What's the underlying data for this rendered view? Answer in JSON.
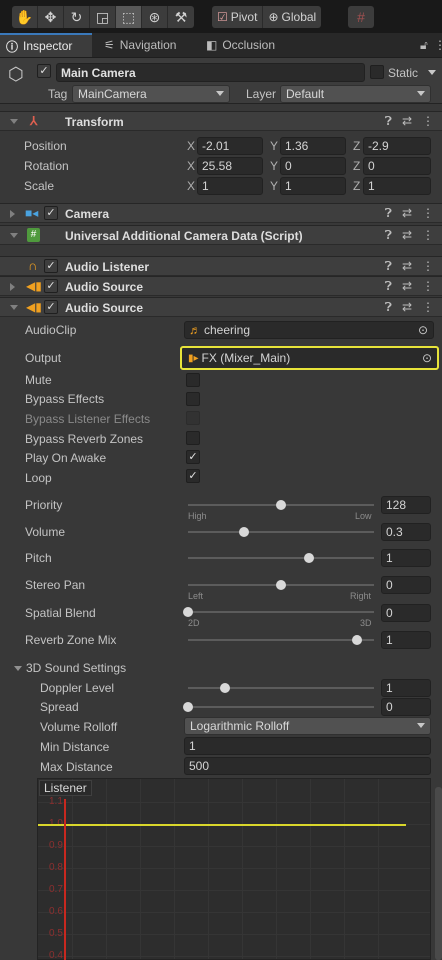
{
  "toolbar": {
    "pivot_label": "Pivot",
    "global_label": "Global"
  },
  "tabs": [
    {
      "label": "Inspector",
      "icon": "info-icon"
    },
    {
      "label": "Navigation",
      "icon": "navigation-icon"
    },
    {
      "label": "Occlusion",
      "icon": "occlusion-icon"
    }
  ],
  "object": {
    "name": "Main Camera",
    "static_label": "Static",
    "tag_label": "Tag",
    "tag_value": "MainCamera",
    "layer_label": "Layer",
    "layer_value": "Default"
  },
  "transform": {
    "title": "Transform",
    "position": {
      "label": "Position",
      "x": "-2.01",
      "y": "1.36",
      "z": "-2.9"
    },
    "rotation": {
      "label": "Rotation",
      "x": "25.58",
      "y": "0",
      "z": "0"
    },
    "scale": {
      "label": "Scale",
      "x": "1",
      "y": "1",
      "z": "1"
    },
    "axis_x": "X",
    "axis_y": "Y",
    "axis_z": "Z"
  },
  "components": {
    "camera": "Camera",
    "urp_data": "Universal Additional Camera Data (Script)",
    "audio_listener": "Audio Listener",
    "audio_source_1": "Audio Source",
    "audio_source_2": "Audio Source"
  },
  "audio_source": {
    "audioclip_label": "AudioClip",
    "audioclip_value": "cheering",
    "output_label": "Output",
    "output_value": "FX (Mixer_Main)",
    "mute_label": "Mute",
    "mute_checked": false,
    "bypass_effects_label": "Bypass Effects",
    "bypass_effects_checked": false,
    "bypass_listener_label": "Bypass Listener Effects",
    "bypass_reverb_label": "Bypass Reverb Zones",
    "bypass_reverb_checked": false,
    "play_on_awake_label": "Play On Awake",
    "play_on_awake_checked": true,
    "loop_label": "Loop",
    "loop_checked": true,
    "check_glyph": "✓",
    "priority": {
      "label": "Priority",
      "value": "128",
      "min_label": "High",
      "max_label": "Low",
      "level": 0.5
    },
    "volume": {
      "label": "Volume",
      "value": "0.3",
      "level": 0.3
    },
    "pitch": {
      "label": "Pitch",
      "value": "1",
      "level": 0.65
    },
    "stereo_pan": {
      "label": "Stereo Pan",
      "value": "0",
      "min_label": "Left",
      "max_label": "Right",
      "level": 0.5
    },
    "spatial_blend": {
      "label": "Spatial Blend",
      "value": "0",
      "min_label": "2D",
      "max_label": "3D",
      "level": 0.0
    },
    "reverb_zone_mix": {
      "label": "Reverb Zone Mix",
      "value": "1",
      "level": 0.91
    }
  },
  "sound_3d": {
    "title": "3D Sound Settings",
    "doppler": {
      "label": "Doppler Level",
      "value": "1",
      "level": 0.2
    },
    "spread": {
      "label": "Spread",
      "value": "0",
      "level": 0.0
    },
    "rolloff_label": "Volume Rolloff",
    "rolloff_value": "Logarithmic Rolloff",
    "min_distance_label": "Min Distance",
    "min_distance_value": "1",
    "max_distance_label": "Max Distance",
    "max_distance_value": "500"
  },
  "graph": {
    "listener_label": "Listener",
    "y_ticks": [
      "1.1",
      "1.0",
      "0.9",
      "0.8",
      "0.7",
      "0.6",
      "0.5",
      "0.4"
    ]
  },
  "colors": {
    "highlight": "#e8e43a",
    "accent_blue": "#3a79bb",
    "curve_red": "#c8281f",
    "curve_yellow": "#d9d62b"
  }
}
